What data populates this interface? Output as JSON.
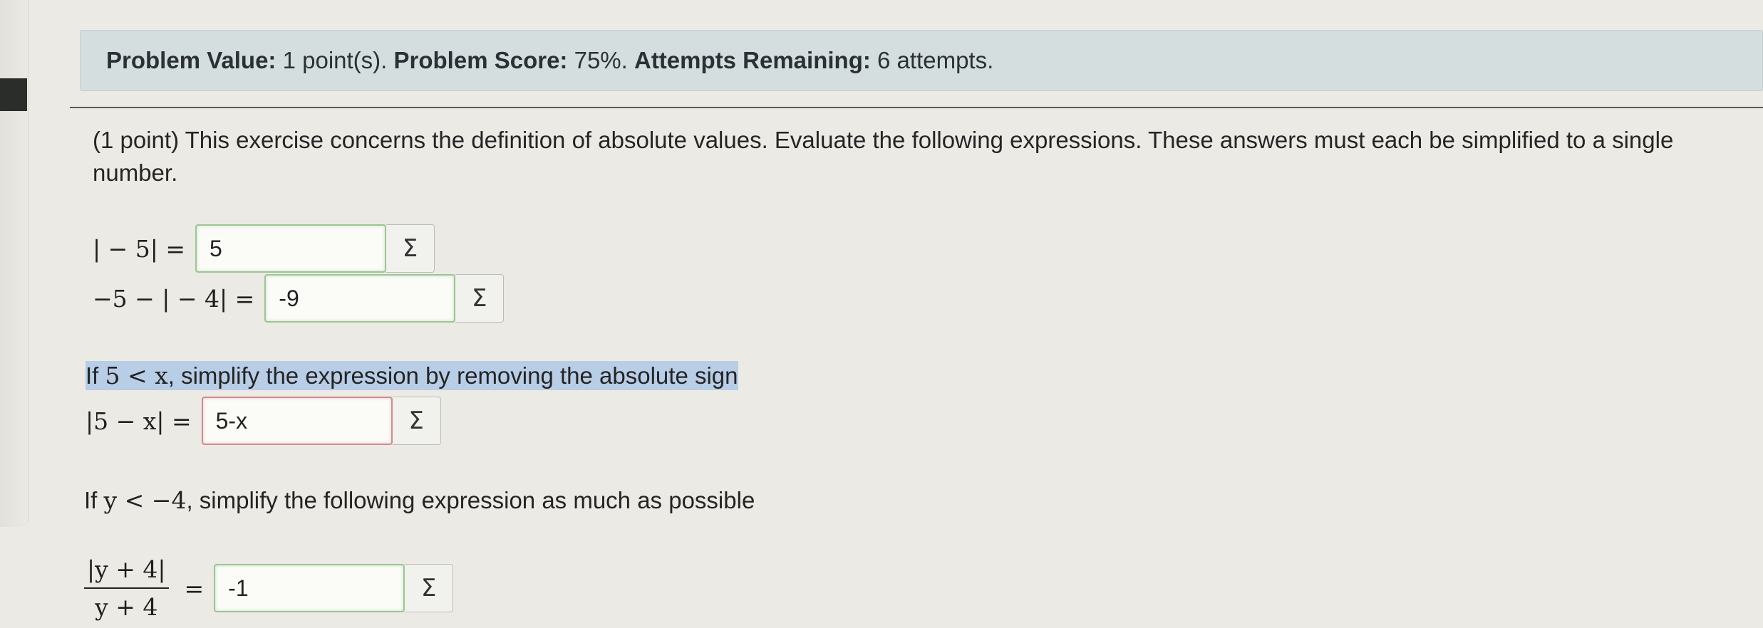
{
  "header": {
    "problem_value_label": "Problem Value:",
    "problem_value": "1 point(s).",
    "problem_score_label": "Problem Score:",
    "problem_score": "75%.",
    "attempts_label": "Attempts Remaining:",
    "attempts": "6 attempts."
  },
  "problem": {
    "intro": "(1 point) This exercise concerns the definition of absolute values. Evaluate the following expressions. These answers must each be simplified to a single number.",
    "q1_lhs": "| − 5| =",
    "q1_answer": "5",
    "q2_lhs": "−5 − | − 4| =",
    "q2_answer": "-9",
    "section2_prefix": "If ",
    "section2_math": "5 < x",
    "section2_suffix": ", simplify the expression by removing the absolute sign",
    "q3_lhs": "|5 − x| =",
    "q3_answer": "5-x",
    "section3_prefix": "If ",
    "section3_math": "y < −4",
    "section3_suffix": ", simplify the following expression as much as possible",
    "q4_numerator": "|y + 4|",
    "q4_denominator": "y + 4",
    "q4_equals": "=",
    "q4_answer": "-1",
    "sigma_symbol": "Σ"
  },
  "colors": {
    "info_bar_bg": "#d5dede",
    "correct_border": "#9cc593",
    "incorrect_border": "#cf8c8c",
    "highlight": "#b8cde6"
  }
}
